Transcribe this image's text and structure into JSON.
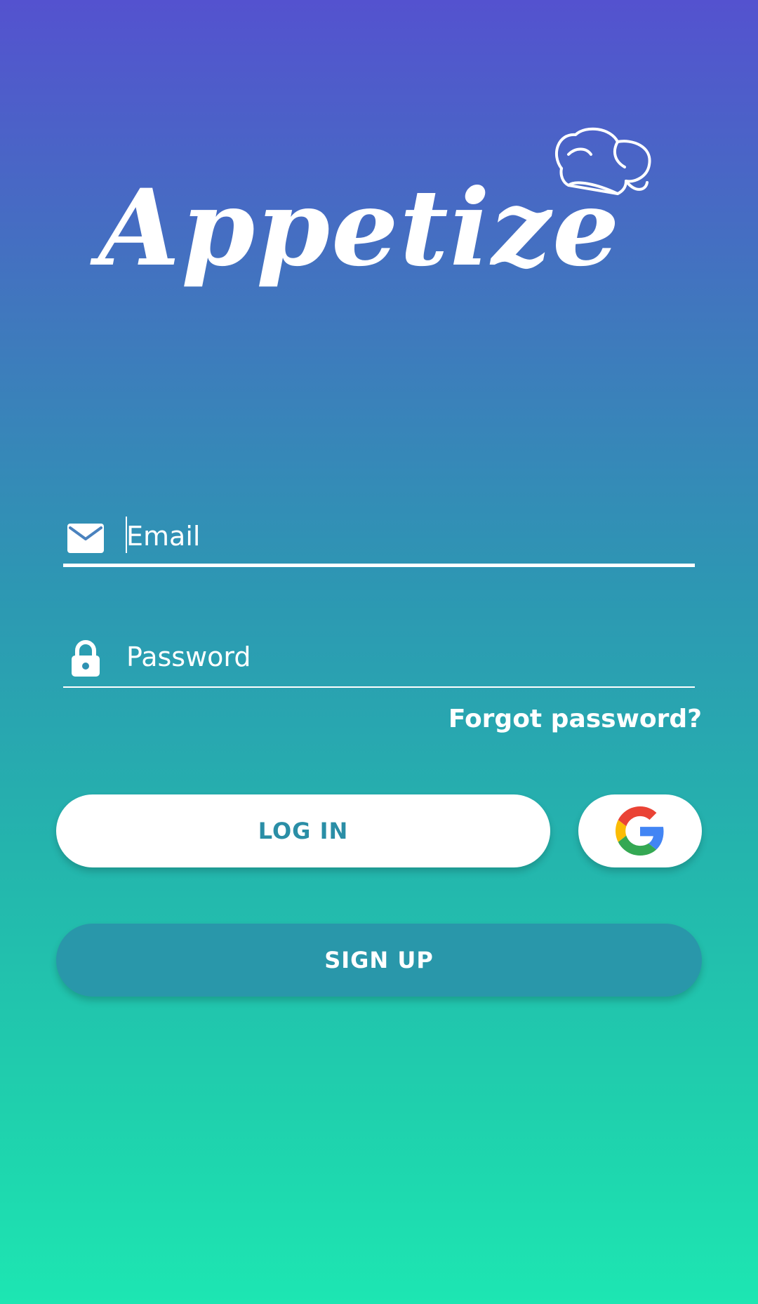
{
  "app": {
    "logo_text": "Appetize"
  },
  "login_form": {
    "email": {
      "placeholder": "Email",
      "value": ""
    },
    "password": {
      "placeholder": "Password",
      "value": ""
    },
    "forgot_password_label": "Forgot password?",
    "login_button_label": "LOG IN",
    "signup_button_label": "SIGN UP"
  },
  "icons": {
    "email": "envelope-icon",
    "password": "lock-icon",
    "google": "google-icon",
    "logo_decoration": "chef-hat-icon"
  },
  "colors": {
    "gradient_top": "#5452cf",
    "gradient_bottom": "#1de6b2",
    "login_text": "#2a8ea6",
    "signup_background": "#2997aa"
  }
}
